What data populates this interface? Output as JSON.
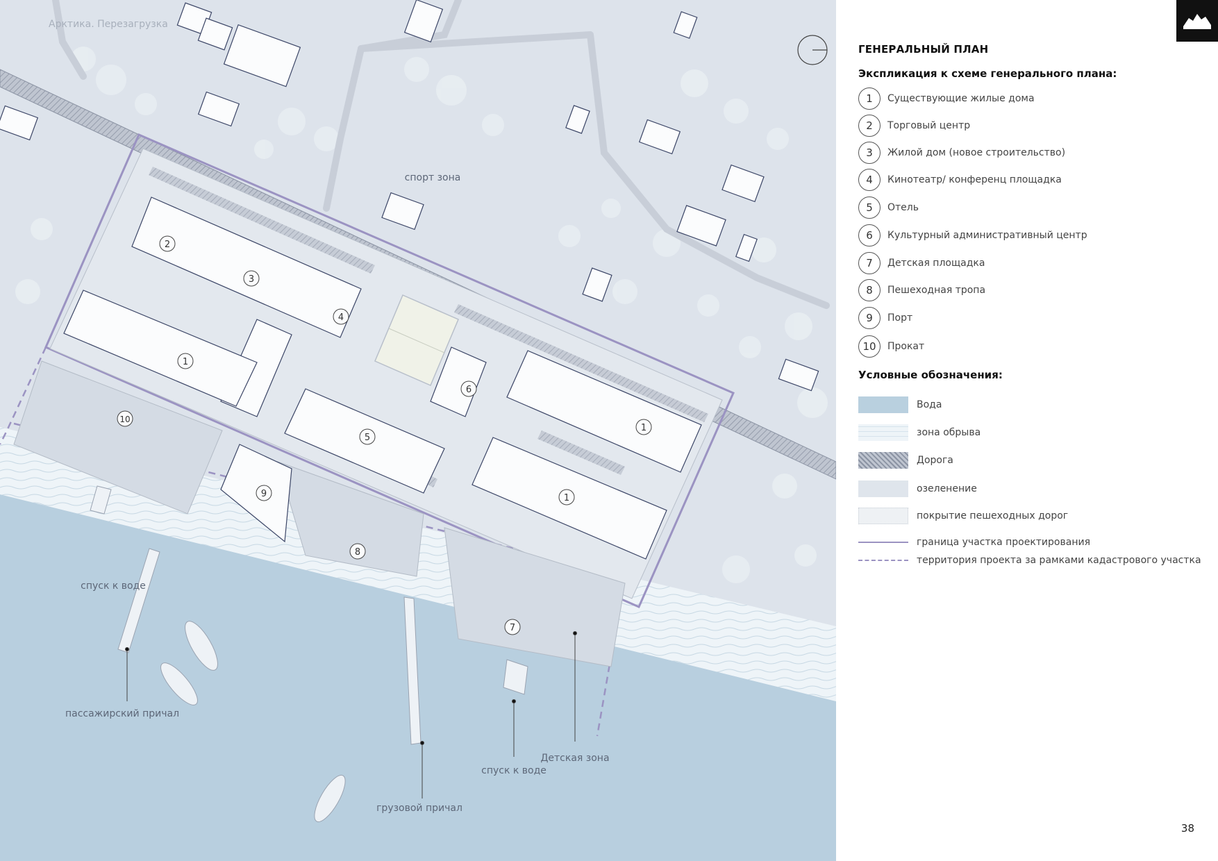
{
  "header": {
    "subtitle": "Арктика. Перезагрузка"
  },
  "panel": {
    "title": "ГЕНЕРАЛЬНЫЙ ПЛАН",
    "explication_title": "Экспликация к схеме генерального плана:",
    "items": [
      {
        "num": "1",
        "label": "Существующие жилые дома"
      },
      {
        "num": "2",
        "label": "Торговый центр"
      },
      {
        "num": "3",
        "label": "Жилой дом (новое строительство)"
      },
      {
        "num": "4",
        "label": "Кинотеатр/ конференц площадка"
      },
      {
        "num": "5",
        "label": "Отель"
      },
      {
        "num": "6",
        "label": "Культурный административный центр"
      },
      {
        "num": "7",
        "label": "Детская площадка"
      },
      {
        "num": "8",
        "label": "Пешеходная тропа"
      },
      {
        "num": "9",
        "label": "Порт"
      },
      {
        "num": "10",
        "label": "Прокат"
      }
    ],
    "legend_title": "Условные обозначения:",
    "legend": [
      {
        "label": "Вода",
        "kind": "water",
        "color": "#b9d0df"
      },
      {
        "label": "зона обрыва",
        "kind": "cliff",
        "color": "#eef4f8"
      },
      {
        "label": "Дорога",
        "kind": "road",
        "color": "#a9afbd"
      },
      {
        "label": "озеленение",
        "kind": "green",
        "color": "#dfe5ec"
      },
      {
        "label": "покрытие пешеходных дорог",
        "kind": "walk",
        "color": "#eef1f4"
      },
      {
        "label": "граница участка проектирования",
        "kind": "line",
        "color": "#9b93c2"
      },
      {
        "label": "территория проекта за рамками кадастрового участка",
        "kind": "dashed",
        "color": "#9b93c2"
      }
    ],
    "page_number": "38"
  },
  "map_labels": {
    "sport": "спорт зона",
    "descent_left": "спуск к воде",
    "passenger_pier": "пассажирский причал",
    "cargo_pier": "грузовой причал",
    "descent_right": "спуск к воде",
    "kids_zone": "Детская зона"
  },
  "map_numbers": {
    "n1a": "1",
    "n1b": "1",
    "n1c": "1",
    "n2": "2",
    "n3": "3",
    "n4": "4",
    "n5": "5",
    "n6": "6",
    "n7": "7",
    "n8": "8",
    "n9": "9",
    "n10": "10"
  },
  "colors": {
    "land": "#dde3eb",
    "water": "#b8cfdf",
    "building": "#fbfcfd",
    "boundary": "#9b93c2",
    "road": "#a7adbb",
    "accent": "#111111"
  }
}
